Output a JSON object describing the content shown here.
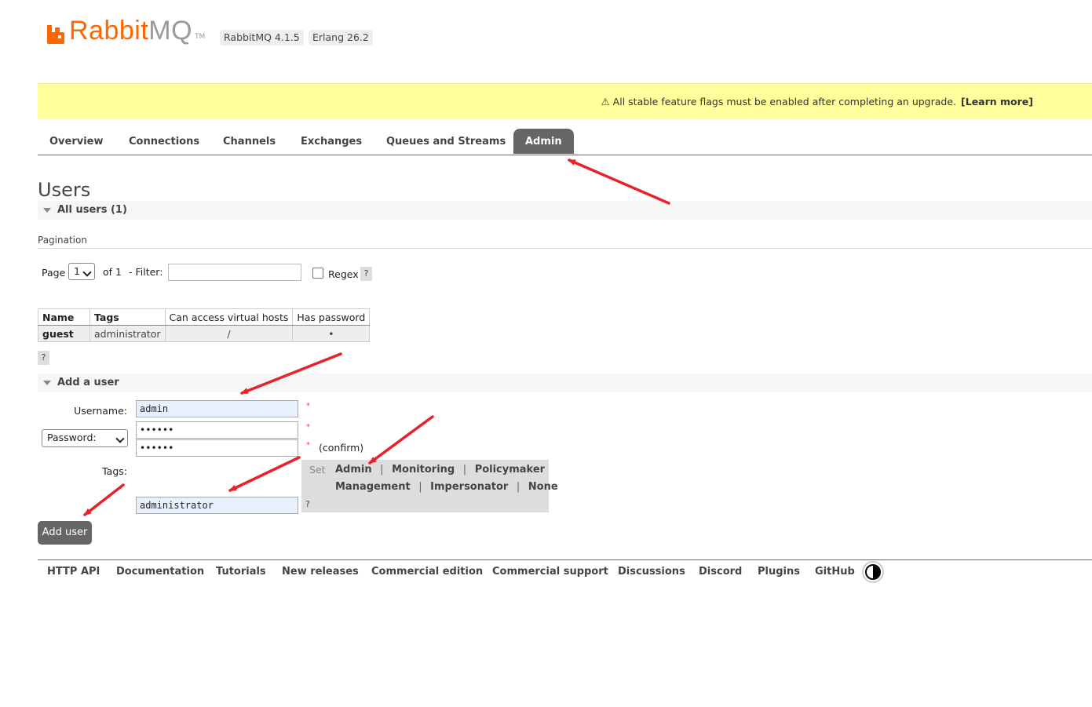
{
  "header": {
    "logo_text_a": "Rabbit",
    "logo_text_b": "MQ",
    "logo_tm": "TM",
    "version": "RabbitMQ 4.1.5",
    "erlang": "Erlang 26.2",
    "brand_color": "#ff6600"
  },
  "banner": {
    "message": "⚠ All stable feature flags must be enabled after completing an upgrade.",
    "link": "[Learn more]"
  },
  "tabs": [
    {
      "label": "Overview"
    },
    {
      "label": "Connections"
    },
    {
      "label": "Channels"
    },
    {
      "label": "Exchanges"
    },
    {
      "label": "Queues and Streams"
    },
    {
      "label": "Admin",
      "active": true
    }
  ],
  "page_title": "Users",
  "all_users_section": "All users (1)",
  "pagination": {
    "heading": "Pagination",
    "page_label": "Page",
    "page_value": "1",
    "of_label": "of 1",
    "filter_label": "- Filter:",
    "filter_value": "",
    "regex_label": "Regex",
    "help": "?"
  },
  "users_table": {
    "headers": [
      "Name",
      "Tags",
      "Can access virtual hosts",
      "Has password"
    ],
    "rows": [
      [
        "guest",
        "administrator",
        "/",
        "•"
      ]
    ],
    "help": "?"
  },
  "add_user": {
    "section": "Add a user",
    "username_label": "Username:",
    "username_value": "admin",
    "password_type": "Password:",
    "password_value": "••••••",
    "confirm_value": "••••••",
    "confirm_label": "(confirm)",
    "required_mark": "*",
    "tags_label": "Tags:",
    "tags_value": "administrator",
    "set_label": "Set",
    "tag_options": [
      "Admin",
      "Monitoring",
      "Policymaker",
      "Management",
      "Impersonator",
      "None"
    ],
    "separator": "|",
    "help": "?",
    "button": "Add user"
  },
  "footer": {
    "links": [
      "HTTP API",
      "Documentation",
      "Tutorials",
      "New releases",
      "Commercial edition",
      "Commercial support",
      "Discussions",
      "Discord",
      "Plugins",
      "GitHub"
    ]
  },
  "annotation_color": "#e8212b"
}
